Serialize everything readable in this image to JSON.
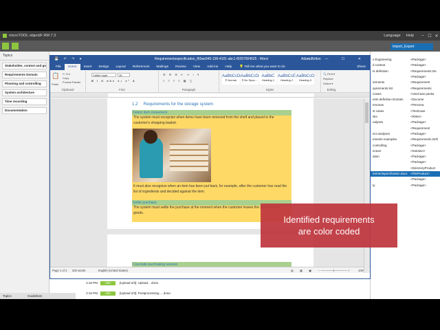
{
  "host": {
    "title": "microTOOL objectiF RM 7.3",
    "menu": [
      "Language",
      "Help"
    ],
    "export_button": "Import_Export",
    "sidebar_header": "Topics",
    "sidebar_items": [
      "Stakeholder, context and goals",
      "Requirements Domain",
      "Planning and controlling",
      "System architecture",
      "Time recording",
      "Documentation"
    ],
    "footer_tabs": [
      "Topics",
      "Guidelines"
    ],
    "tree": [
      {
        "l": "s Engineering",
        "r": "<Package>"
      },
      {
        "l": "d context",
        "r": "<Package>"
      },
      {
        "l": "ts definition",
        "r": "<Requirements De"
      },
      {
        "l": "",
        "r": "<Package>"
      },
      {
        "l": "irements",
        "r": "<Requirement"
      },
      {
        "l": "quirements list",
        "r": "<Requirements"
      },
      {
        "l": "Cases",
        "r": "<UseCase packa"
      },
      {
        "l": "ents definition Domain",
        "r": "<Docume"
      },
      {
        "l": "ersonas",
        "r": "<Persona"
      },
      {
        "l": "st cases",
        "r": "<TestCase"
      },
      {
        "l": "sks",
        "r": "<Risks>"
      },
      {
        "l": "nalyses",
        "r": "<Package>"
      },
      {
        "l": "",
        "r": "<Requirement"
      },
      {
        "l": "ect analyses",
        "r": "<Package>"
      },
      {
        "l": "ements examples",
        "r": "<Requirements Defi"
      },
      {
        "l": "controlling",
        "r": "<Package>"
      },
      {
        "l": "ecture",
        "r": "<Solution>"
      },
      {
        "l": "ation",
        "r": "<Package>"
      },
      {
        "l": "",
        "r": "<Package>"
      },
      {
        "l": "",
        "r": "<DirectoryProduct"
      },
      {
        "l": "irementspecification.docx",
        "r": "<FileProduct>"
      },
      {
        "l": "",
        "r": "<Package>"
      },
      {
        "l": "ty",
        "r": "<Package>"
      }
    ],
    "log": [
      {
        "time": "2:16 PM",
        "tag": "Info",
        "text": "[Upload 2/3]: Upload... done."
      },
      {
        "time": "2:16 PM",
        "tag": "Info",
        "text": "[Upload 2/3]: Postprocessing ... done."
      }
    ]
  },
  "word": {
    "qat": "💾 ↶ ↷ ▾",
    "title": "Requirementsspecification_f60ae945-199-4101-abc1-f0267004525 - Word",
    "user": "Adam Bolton",
    "controls": "▭ — ☐ ✕",
    "tabs": [
      "File",
      "Home",
      "Insert",
      "Design",
      "Layout",
      "References",
      "Mailings",
      "Review",
      "View",
      "Add-ins",
      "Help"
    ],
    "active_tab": "Home",
    "tell_me": "💡 Tell me what you want to do",
    "share": "Share",
    "ribbon": {
      "paste": "Paste",
      "cut": "✂ Cut",
      "copy": "Copy",
      "format_painter": "Format Painter",
      "clipboard": "Clipboard",
      "font_name": "Calibri Light",
      "font_size": "16",
      "font": "Font",
      "paragraph": "Paragraph",
      "styles_label": "Styles",
      "styles": [
        {
          "big": "AaBbCcDc",
          "name": "¶ Normal"
        },
        {
          "big": "AaBbCcDc",
          "name": "¶ No Spac..."
        },
        {
          "big": "AaBbC",
          "name": "Heading 1"
        },
        {
          "big": "AaBbCcE",
          "name": "Heading 2"
        },
        {
          "big": "AaBbCcD",
          "name": "Heading 3"
        }
      ],
      "find": "🔍 Find ▾",
      "replace": "Replace",
      "select": "Select ▾",
      "editing": "Editing"
    },
    "heading_num": "1.2",
    "heading_text": "Requirements for the storage system",
    "sections": [
      {
        "title": "Detect item movement",
        "body1": "The system must recognize when items have been removed from the shelf and placed in the customer's shopping basket.",
        "body2": "It must also recognize when an item has been put back, for example, after the customer has read the list of ingredients and decided against the item."
      },
      {
        "title": "Settle purchase",
        "body1": "The system must settle the purchase at the moment when the customer leaves the store with the goods."
      },
      {
        "title": "Conclude purchasing session"
      }
    ],
    "status": {
      "page": "Page 1 of 2",
      "words": "302 words",
      "lang": "English (United States)",
      "zoom": "100%"
    }
  },
  "callout": {
    "line1": "Identified requirements",
    "line2": "are color coded"
  }
}
